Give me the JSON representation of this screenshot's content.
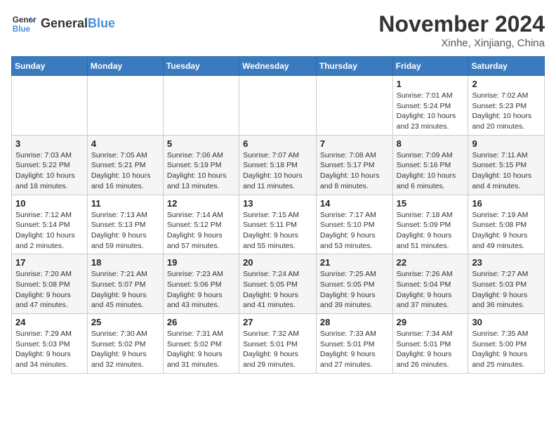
{
  "header": {
    "logo_line1": "General",
    "logo_line2": "Blue",
    "month": "November 2024",
    "location": "Xinhe, Xinjiang, China"
  },
  "weekdays": [
    "Sunday",
    "Monday",
    "Tuesday",
    "Wednesday",
    "Thursday",
    "Friday",
    "Saturday"
  ],
  "weeks": [
    [
      {
        "day": "",
        "info": ""
      },
      {
        "day": "",
        "info": ""
      },
      {
        "day": "",
        "info": ""
      },
      {
        "day": "",
        "info": ""
      },
      {
        "day": "",
        "info": ""
      },
      {
        "day": "1",
        "info": "Sunrise: 7:01 AM\nSunset: 5:24 PM\nDaylight: 10 hours and 23 minutes."
      },
      {
        "day": "2",
        "info": "Sunrise: 7:02 AM\nSunset: 5:23 PM\nDaylight: 10 hours and 20 minutes."
      }
    ],
    [
      {
        "day": "3",
        "info": "Sunrise: 7:03 AM\nSunset: 5:22 PM\nDaylight: 10 hours and 18 minutes."
      },
      {
        "day": "4",
        "info": "Sunrise: 7:05 AM\nSunset: 5:21 PM\nDaylight: 10 hours and 16 minutes."
      },
      {
        "day": "5",
        "info": "Sunrise: 7:06 AM\nSunset: 5:19 PM\nDaylight: 10 hours and 13 minutes."
      },
      {
        "day": "6",
        "info": "Sunrise: 7:07 AM\nSunset: 5:18 PM\nDaylight: 10 hours and 11 minutes."
      },
      {
        "day": "7",
        "info": "Sunrise: 7:08 AM\nSunset: 5:17 PM\nDaylight: 10 hours and 8 minutes."
      },
      {
        "day": "8",
        "info": "Sunrise: 7:09 AM\nSunset: 5:16 PM\nDaylight: 10 hours and 6 minutes."
      },
      {
        "day": "9",
        "info": "Sunrise: 7:11 AM\nSunset: 5:15 PM\nDaylight: 10 hours and 4 minutes."
      }
    ],
    [
      {
        "day": "10",
        "info": "Sunrise: 7:12 AM\nSunset: 5:14 PM\nDaylight: 10 hours and 2 minutes."
      },
      {
        "day": "11",
        "info": "Sunrise: 7:13 AM\nSunset: 5:13 PM\nDaylight: 9 hours and 59 minutes."
      },
      {
        "day": "12",
        "info": "Sunrise: 7:14 AM\nSunset: 5:12 PM\nDaylight: 9 hours and 57 minutes."
      },
      {
        "day": "13",
        "info": "Sunrise: 7:15 AM\nSunset: 5:11 PM\nDaylight: 9 hours and 55 minutes."
      },
      {
        "day": "14",
        "info": "Sunrise: 7:17 AM\nSunset: 5:10 PM\nDaylight: 9 hours and 53 minutes."
      },
      {
        "day": "15",
        "info": "Sunrise: 7:18 AM\nSunset: 5:09 PM\nDaylight: 9 hours and 51 minutes."
      },
      {
        "day": "16",
        "info": "Sunrise: 7:19 AM\nSunset: 5:08 PM\nDaylight: 9 hours and 49 minutes."
      }
    ],
    [
      {
        "day": "17",
        "info": "Sunrise: 7:20 AM\nSunset: 5:08 PM\nDaylight: 9 hours and 47 minutes."
      },
      {
        "day": "18",
        "info": "Sunrise: 7:21 AM\nSunset: 5:07 PM\nDaylight: 9 hours and 45 minutes."
      },
      {
        "day": "19",
        "info": "Sunrise: 7:23 AM\nSunset: 5:06 PM\nDaylight: 9 hours and 43 minutes."
      },
      {
        "day": "20",
        "info": "Sunrise: 7:24 AM\nSunset: 5:05 PM\nDaylight: 9 hours and 41 minutes."
      },
      {
        "day": "21",
        "info": "Sunrise: 7:25 AM\nSunset: 5:05 PM\nDaylight: 9 hours and 39 minutes."
      },
      {
        "day": "22",
        "info": "Sunrise: 7:26 AM\nSunset: 5:04 PM\nDaylight: 9 hours and 37 minutes."
      },
      {
        "day": "23",
        "info": "Sunrise: 7:27 AM\nSunset: 5:03 PM\nDaylight: 9 hours and 36 minutes."
      }
    ],
    [
      {
        "day": "24",
        "info": "Sunrise: 7:29 AM\nSunset: 5:03 PM\nDaylight: 9 hours and 34 minutes."
      },
      {
        "day": "25",
        "info": "Sunrise: 7:30 AM\nSunset: 5:02 PM\nDaylight: 9 hours and 32 minutes."
      },
      {
        "day": "26",
        "info": "Sunrise: 7:31 AM\nSunset: 5:02 PM\nDaylight: 9 hours and 31 minutes."
      },
      {
        "day": "27",
        "info": "Sunrise: 7:32 AM\nSunset: 5:01 PM\nDaylight: 9 hours and 29 minutes."
      },
      {
        "day": "28",
        "info": "Sunrise: 7:33 AM\nSunset: 5:01 PM\nDaylight: 9 hours and 27 minutes."
      },
      {
        "day": "29",
        "info": "Sunrise: 7:34 AM\nSunset: 5:01 PM\nDaylight: 9 hours and 26 minutes."
      },
      {
        "day": "30",
        "info": "Sunrise: 7:35 AM\nSunset: 5:00 PM\nDaylight: 9 hours and 25 minutes."
      }
    ]
  ]
}
